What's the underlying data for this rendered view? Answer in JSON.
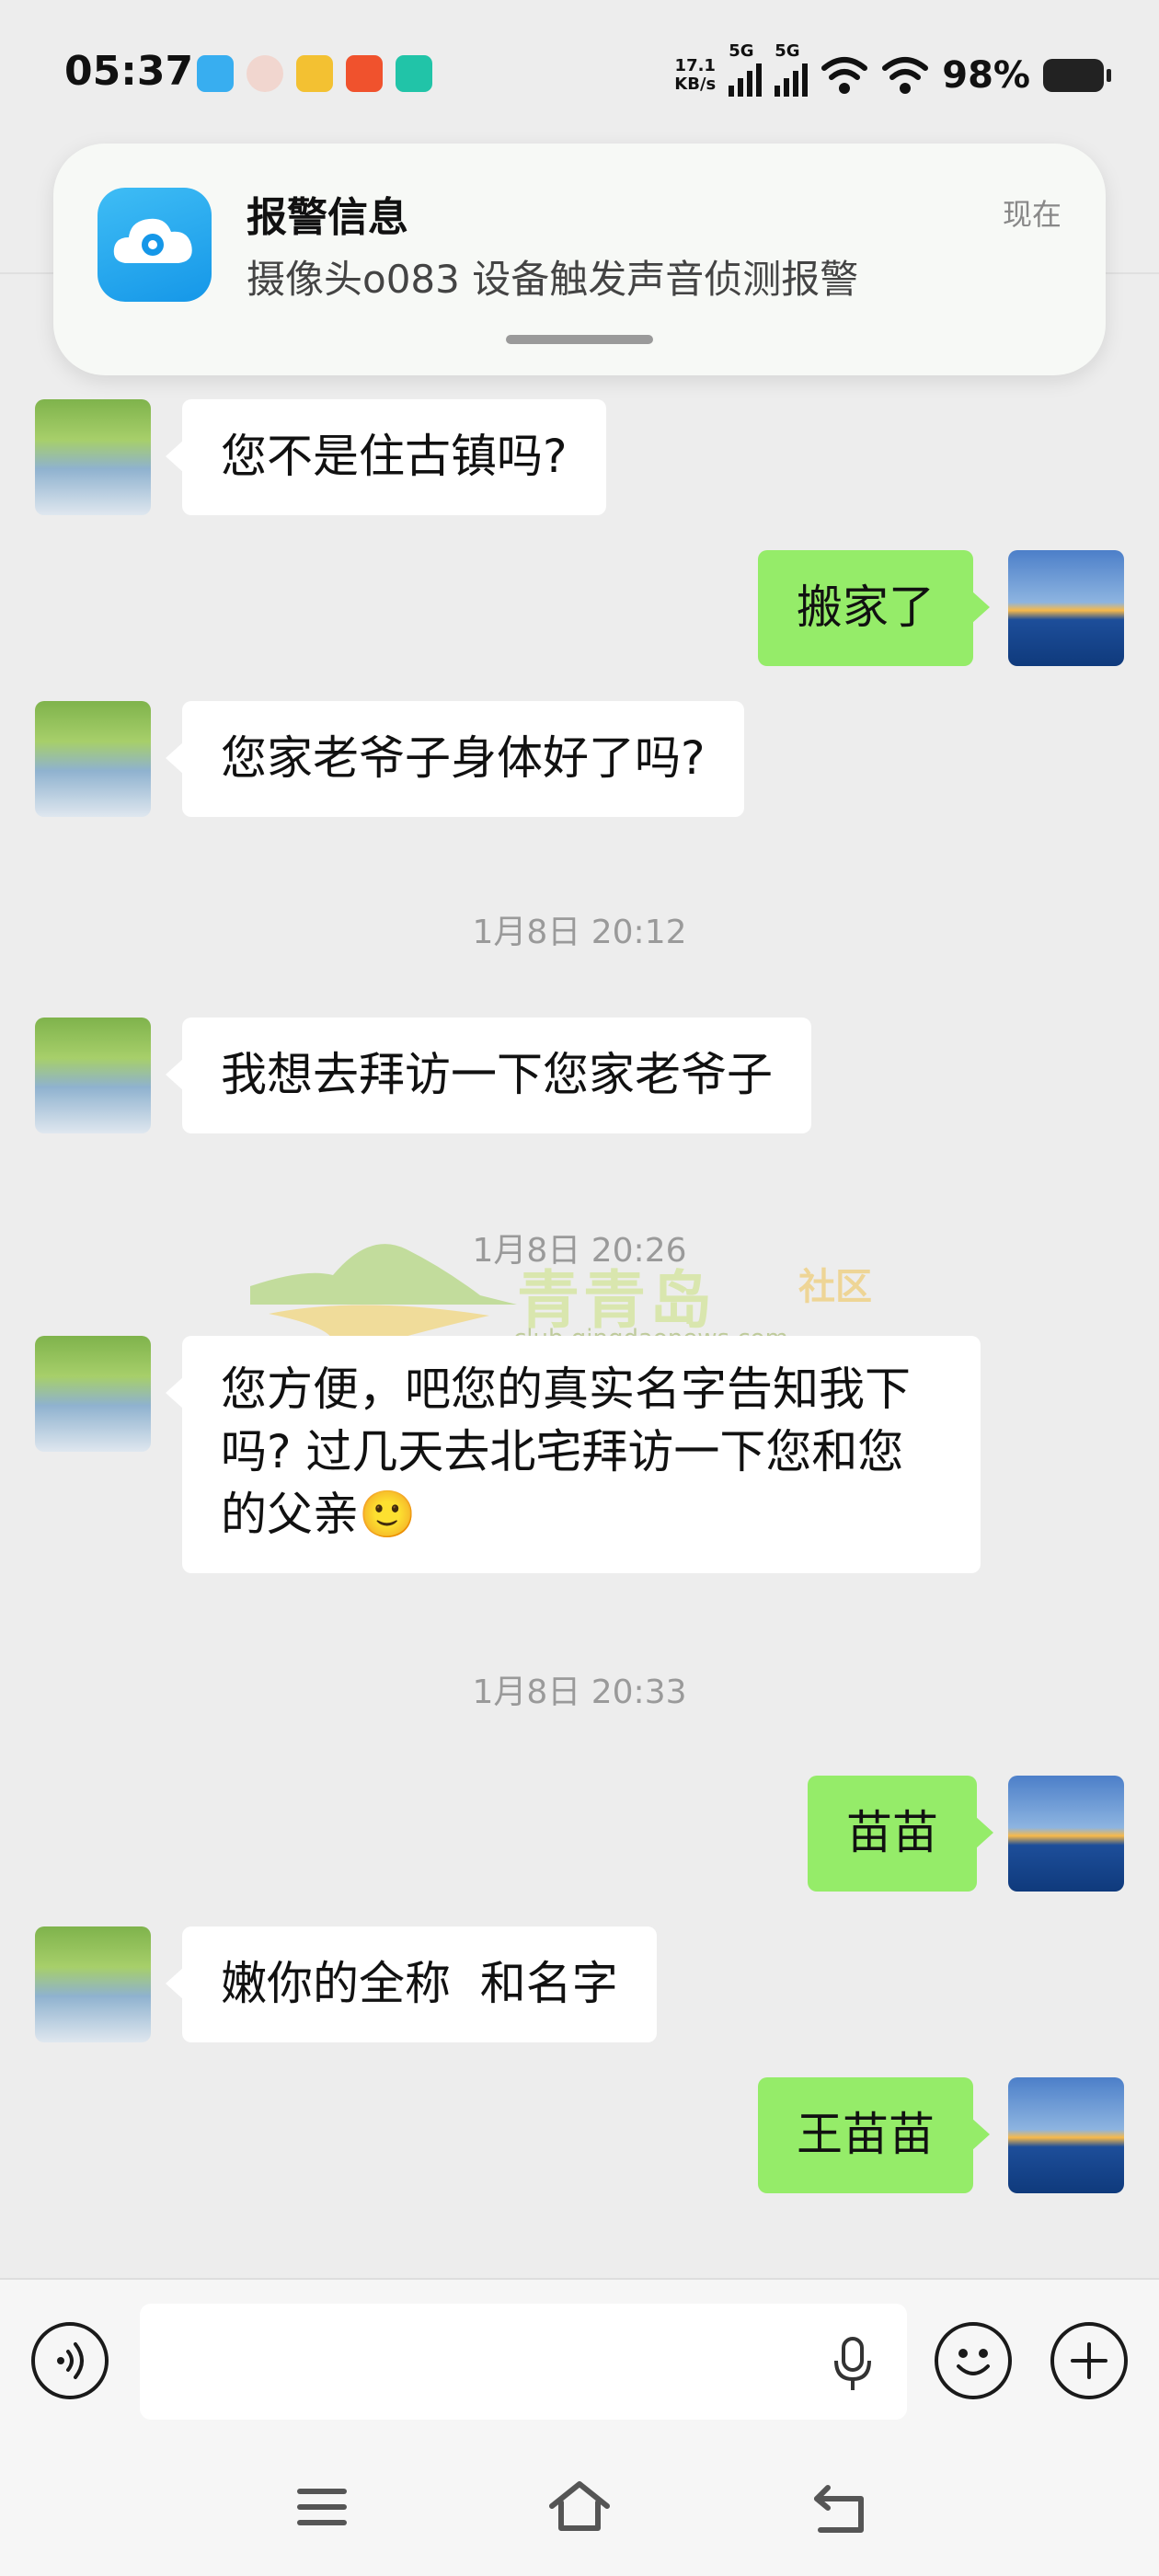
{
  "status_bar": {
    "time": "05:37",
    "net_speed_value": "17.1",
    "net_speed_unit": "KB/s",
    "sim1_tag": "5G",
    "sim2_tag": "5G",
    "battery": "98%",
    "app_icons": [
      "app-icon-blue",
      "app-icon-avatar",
      "app-icon-yellow",
      "app-icon-orange",
      "app-icon-teal"
    ]
  },
  "notification": {
    "title": "报警信息",
    "time": "现在",
    "body": "摄像头o083 设备触发声音侦测报警",
    "icon": "camera-cloud-icon"
  },
  "chat": {
    "messages": [
      {
        "side": "in",
        "text": "您不是住古镇吗?"
      },
      {
        "side": "out",
        "text": "搬家了"
      },
      {
        "side": "in",
        "text": "您家老爷子身体好了吗?"
      },
      {
        "side": "time",
        "text": "1月8日 20:12"
      },
      {
        "side": "in",
        "text": "我想去拜访一下您家老爷子"
      },
      {
        "side": "time",
        "text": "1月8日 20:26"
      },
      {
        "side": "in",
        "text": "您方便，吧您的真实名字告知我下吗? 过几天去北宅拜访一下您和您的父亲🙂"
      },
      {
        "side": "time",
        "text": "1月8日 20:33"
      },
      {
        "side": "out",
        "text": "苗苗"
      },
      {
        "side": "in",
        "text": "嫩你的全称  和名字"
      },
      {
        "side": "out",
        "text": "王苗苗"
      }
    ]
  },
  "watermark": {
    "title": "青青岛",
    "tag": "社区",
    "url": "club.qingdaonews.com"
  },
  "input_bar": {
    "placeholder": "",
    "icons": [
      "voice-icon",
      "mic-icon",
      "emoji-icon",
      "plus-icon"
    ]
  },
  "nav_bar": {
    "icons": [
      "menu-icon",
      "home-icon",
      "back-icon"
    ]
  },
  "colors": {
    "background": "#ededed",
    "incoming_bubble": "#ffffff",
    "outgoing_bubble": "#95ec69",
    "timestamp": "#9a9a9a"
  }
}
